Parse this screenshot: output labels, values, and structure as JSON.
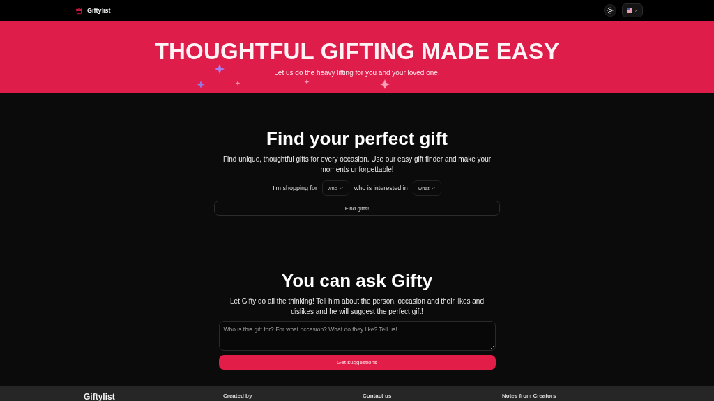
{
  "navbar": {
    "brand": "Giftylist"
  },
  "hero": {
    "title": "THOUGHTFUL GIFTING MADE EASY",
    "subtitle": "Let us do the heavy lifting for you and your loved one."
  },
  "finder": {
    "title": "Find your perfect gift",
    "description": "Find unique, thoughtful gifts for every occasion. Use our easy gift finder and make your moments unforgettable!",
    "label_1": "I'm shopping for",
    "select_1": "who",
    "label_2": "who is interested in",
    "select_2": "what",
    "button": "Find gifts!"
  },
  "ask": {
    "title": "You can ask Gifty",
    "description": "Let Gifty do all the thinking! Tell him about the person, occasion and their likes and dislikes and he will suggest the perfect gift!",
    "placeholder": "Who is this gift for? For what occasion? What do they like? Tell us!",
    "button": "Get suggestions"
  },
  "footer": {
    "brand": "Giftylist",
    "columns": [
      "Created by",
      "Contact us",
      "Notes from Creators"
    ]
  }
}
